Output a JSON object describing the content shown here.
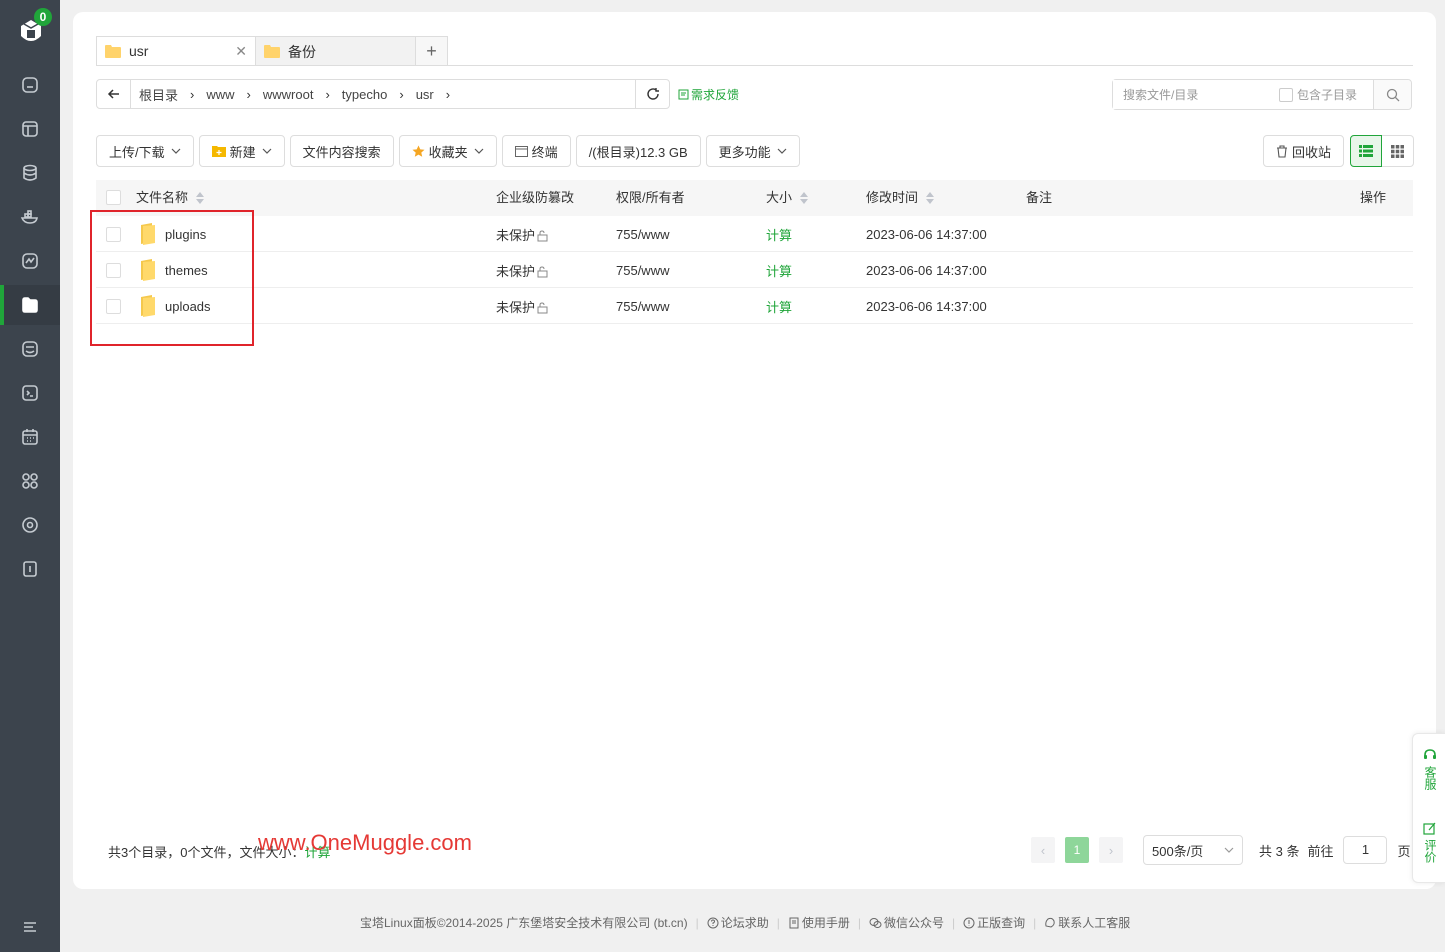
{
  "sidebar": {
    "badge": "0",
    "items": [
      {
        "icon": "home-icon"
      },
      {
        "icon": "website-icon"
      },
      {
        "icon": "database-icon"
      },
      {
        "icon": "docker-icon"
      },
      {
        "icon": "monitor-icon"
      },
      {
        "icon": "files-icon",
        "active": true
      },
      {
        "icon": "logs-icon"
      },
      {
        "icon": "terminal-icon"
      },
      {
        "icon": "cron-icon"
      },
      {
        "icon": "apps-icon"
      },
      {
        "icon": "settings-icon"
      },
      {
        "icon": "logout-icon"
      }
    ],
    "collapse_icon": "menu-icon"
  },
  "tabs": [
    {
      "label": "usr",
      "active": true
    },
    {
      "label": "备份",
      "active": false
    }
  ],
  "tab_add": "+",
  "breadcrumb": [
    "根目录",
    "www",
    "wwwroot",
    "typecho",
    "usr"
  ],
  "feedback": "需求反馈",
  "search": {
    "placeholder": "搜索文件/目录",
    "subdir_label": "包含子目录"
  },
  "toolbar": {
    "upload": "上传/下载",
    "new": "新建",
    "content_search": "文件内容搜索",
    "favorites": "收藏夹",
    "terminal": "终端",
    "disk": "/(根目录)12.3 GB",
    "more": "更多功能",
    "recycle": "回收站"
  },
  "table": {
    "headers": {
      "name": "文件名称",
      "protect": "企业级防篡改",
      "perm": "权限/所有者",
      "size": "大小",
      "mtime": "修改时间",
      "note": "备注",
      "ops": "操作"
    },
    "rows": [
      {
        "name": "plugins",
        "protect": "未保护",
        "perm": "755/www",
        "size": "计算",
        "mtime": "2023-06-06 14:37:00"
      },
      {
        "name": "themes",
        "protect": "未保护",
        "perm": "755/www",
        "size": "计算",
        "mtime": "2023-06-06 14:37:00"
      },
      {
        "name": "uploads",
        "protect": "未保护",
        "perm": "755/www",
        "size": "计算",
        "mtime": "2023-06-06 14:37:00"
      }
    ]
  },
  "summary": {
    "text": "共3个目录，0个文件，文件大小：",
    "calc": "计算"
  },
  "watermark": "www.OneMuggle.com",
  "pager": {
    "current": "1",
    "page_size": "500条/页",
    "total": "共 3 条",
    "goto": "前往",
    "goto_value": "1",
    "page_unit": "页"
  },
  "float": {
    "service": "客服",
    "review": "评价"
  },
  "footer": {
    "copyright": "宝塔Linux面板©2014-2025 广东堡塔安全技术有限公司 (bt.cn)",
    "links": [
      "论坛求助",
      "使用手册",
      "微信公众号",
      "正版查询",
      "联系人工客服"
    ]
  },
  "colors": {
    "accent": "#20a53a",
    "sidebar": "#3c444d",
    "highlight_box": "#e0242b"
  }
}
